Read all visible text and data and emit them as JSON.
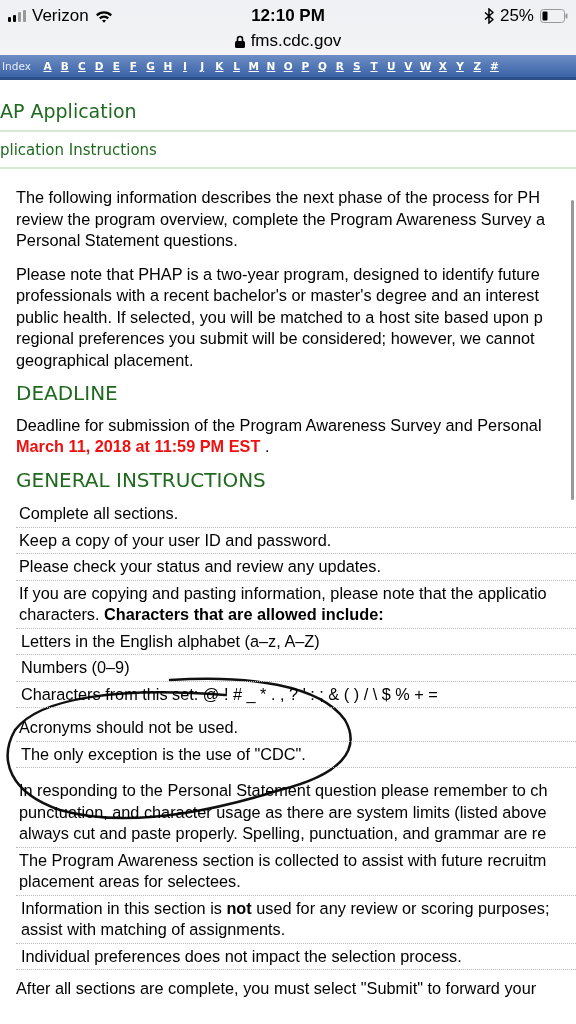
{
  "status_bar": {
    "carrier": "Verizon",
    "time": "12:10 PM",
    "battery": "25%",
    "url": "fms.cdc.gov"
  },
  "index_bar": {
    "label": "Index",
    "letters": [
      "A",
      "B",
      "C",
      "D",
      "E",
      "F",
      "G",
      "H",
      "I",
      "J",
      "K",
      "L",
      "M",
      "N",
      "O",
      "P",
      "Q",
      "R",
      "S",
      "T",
      "U",
      "V",
      "W",
      "X",
      "Y",
      "Z",
      "#"
    ]
  },
  "page_title": "AP Application",
  "section_title": "plication Instructions",
  "intro_paragraphs": [
    [
      "The following information describes the next phase of the process for PH",
      "review the program overview, complete the Program Awareness Survey a",
      "Personal Statement questions."
    ],
    [
      "Please note that PHAP is a two-year program, designed to identify future",
      "professionals with a recent bachelor's or master's degree and an interest",
      "public health. If selected, you will be matched to a host site based upon p",
      "regional preferences you submit will be considered; however, we cannot",
      "geographical placement."
    ]
  ],
  "deadline": {
    "heading": "DEADLINE",
    "text": "Deadline for submission of the Program Awareness Survey and Personal",
    "date": "March 11, 2018 at 11:59 PM EST",
    "after": "."
  },
  "general_instructions": {
    "heading": "GENERAL INSTRUCTIONS",
    "rows": [
      {
        "kind": "item",
        "lines": [
          "Complete all sections."
        ]
      },
      {
        "kind": "item",
        "lines": [
          "Keep a copy of your user ID and password."
        ]
      },
      {
        "kind": "item",
        "lines": [
          "Please check your status and review any updates."
        ]
      },
      {
        "kind": "item",
        "lines": [
          "If you are copying and pasting information, please note that the applicatio",
          "characters. **Characters that are allowed include:**"
        ]
      },
      {
        "kind": "subitem",
        "lines": [
          "Letters in the English alphabet (a–z, A–Z)"
        ]
      },
      {
        "kind": "subitem",
        "lines": [
          "Numbers (0–9)"
        ]
      },
      {
        "kind": "subitem",
        "lines": [
          "Characters from this set: @ ! # _ * . , ? ' : ; & ( ) / \\ $ % + ="
        ]
      },
      {
        "kind": "item",
        "lines": [
          "Acronyms should not be used."
        ]
      },
      {
        "kind": "subitem",
        "lines": [
          "The only exception is the use of \"CDC\"."
        ]
      },
      {
        "kind": "item",
        "lines": [
          "In responding to the Personal Statement question please remember to ch",
          "punctuation, and character usage as there are system limits (listed above",
          "always cut and paste properly. Spelling, punctuation, and grammar are re"
        ]
      },
      {
        "kind": "item",
        "lines": [
          "The Program Awareness section is collected to assist with future recruitm",
          "placement areas for selectees."
        ]
      },
      {
        "kind": "subitem",
        "lines": [
          "Information in this section is **not** used for any review or scoring purposes;",
          "assist with matching of assignments."
        ]
      },
      {
        "kind": "subitem",
        "lines": [
          "Individual preferences does not impact the selection process."
        ]
      }
    ],
    "footer_text": "After all sections are complete, you must select \"Submit\" to forward your"
  }
}
